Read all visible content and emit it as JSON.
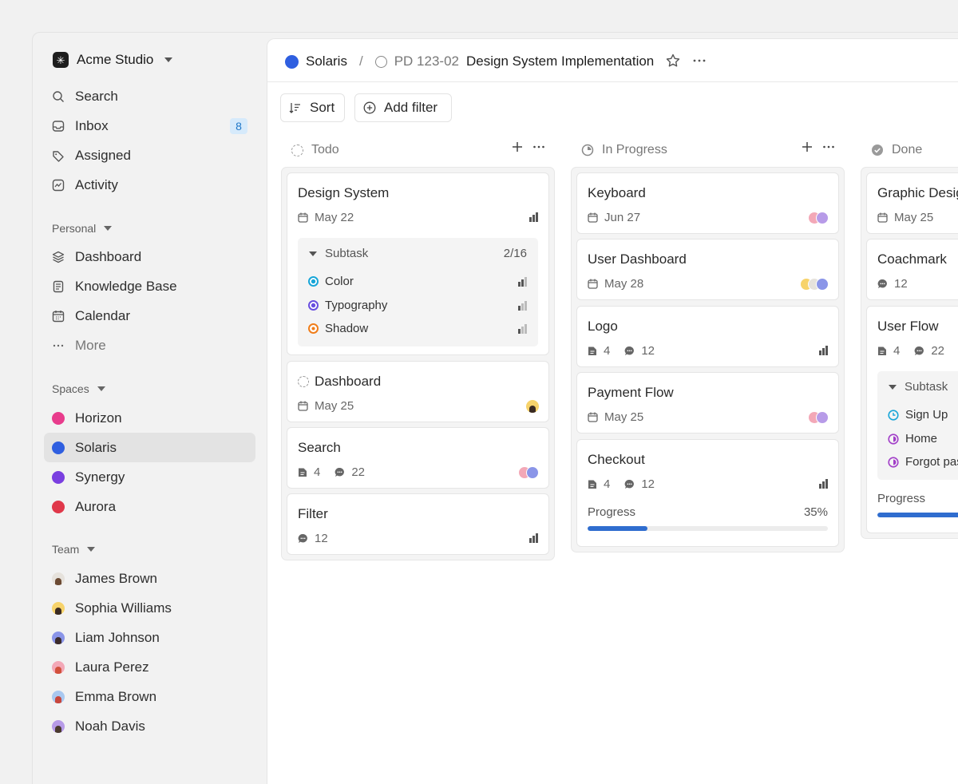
{
  "workspace": {
    "name": "Acme Studio"
  },
  "nav": {
    "main": [
      {
        "label": "Search",
        "icon": "search-icon"
      },
      {
        "label": "Inbox",
        "icon": "inbox-icon",
        "badge": "8"
      },
      {
        "label": "Assigned",
        "icon": "tag-icon"
      },
      {
        "label": "Activity",
        "icon": "activity-icon"
      }
    ],
    "personal_label": "Personal",
    "personal": [
      {
        "label": "Dashboard",
        "icon": "layers-icon"
      },
      {
        "label": "Knowledge Base",
        "icon": "document-icon"
      },
      {
        "label": "Calendar",
        "icon": "calendar-icon"
      },
      {
        "label": "More",
        "icon": "more-icon"
      }
    ],
    "spaces_label": "Spaces",
    "spaces": [
      {
        "label": "Horizon",
        "color": "#e83c8c"
      },
      {
        "label": "Solaris",
        "color": "#2f5fe0"
      },
      {
        "label": "Synergy",
        "color": "#7a3fe0"
      },
      {
        "label": "Aurora",
        "color": "#e0384a"
      }
    ],
    "team_label": "Team",
    "team": [
      {
        "label": "James Brown"
      },
      {
        "label": "Sophia Williams"
      },
      {
        "label": "Liam Johnson"
      },
      {
        "label": "Laura Perez"
      },
      {
        "label": "Emma Brown"
      },
      {
        "label": "Noah Davis"
      }
    ]
  },
  "header": {
    "space": "Solaris",
    "separator": "/",
    "issue_id": "PD 123-02",
    "issue_title": "Design System Implementation"
  },
  "toolbar": {
    "sort": "Sort",
    "filter": "Add filter"
  },
  "columns": {
    "todo": {
      "title": "Todo",
      "cards": {
        "design_system": {
          "title": "Design System",
          "date": "May 22",
          "subtask_label": "Subtask",
          "subtask_count": "2/16",
          "subtasks": [
            {
              "label": "Color",
              "color": "#19a6d8"
            },
            {
              "label": "Typography",
              "color": "#6a4fe0"
            },
            {
              "label": "Shadow",
              "color": "#f07d1a"
            }
          ]
        },
        "dashboard": {
          "title": "Dashboard",
          "date": "May 25"
        },
        "search": {
          "title": "Search",
          "files": "4",
          "comments": "22"
        },
        "filter": {
          "title": "Filter",
          "comments": "12"
        }
      }
    },
    "in_progress": {
      "title": "In Progress",
      "cards": {
        "keyboard": {
          "title": "Keyboard",
          "date": "Jun 27"
        },
        "user_dashboard": {
          "title": "User Dashboard",
          "date": "May 28"
        },
        "logo": {
          "title": "Logo",
          "files": "4",
          "comments": "12"
        },
        "payment_flow": {
          "title": "Payment Flow",
          "date": "May 25"
        },
        "checkout": {
          "title": "Checkout",
          "files": "4",
          "comments": "12",
          "progress_label": "Progress",
          "progress_text": "35%",
          "progress": 0.25
        }
      }
    },
    "done": {
      "title": "Done",
      "cards": {
        "graphic_design": {
          "title": "Graphic Design",
          "date": "May 25"
        },
        "coachmark": {
          "title": "Coachmark",
          "comments": "12"
        },
        "user_flow": {
          "title": "User Flow",
          "files": "4",
          "comments": "22",
          "subtask_label": "Subtask",
          "subtasks": [
            {
              "label": "Sign Up",
              "color": "#19a6d8"
            },
            {
              "label": "Home",
              "color": "#a23fc8"
            },
            {
              "label": "Forgot password",
              "color": "#a23fc8"
            }
          ],
          "progress_label": "Progress"
        }
      }
    }
  }
}
